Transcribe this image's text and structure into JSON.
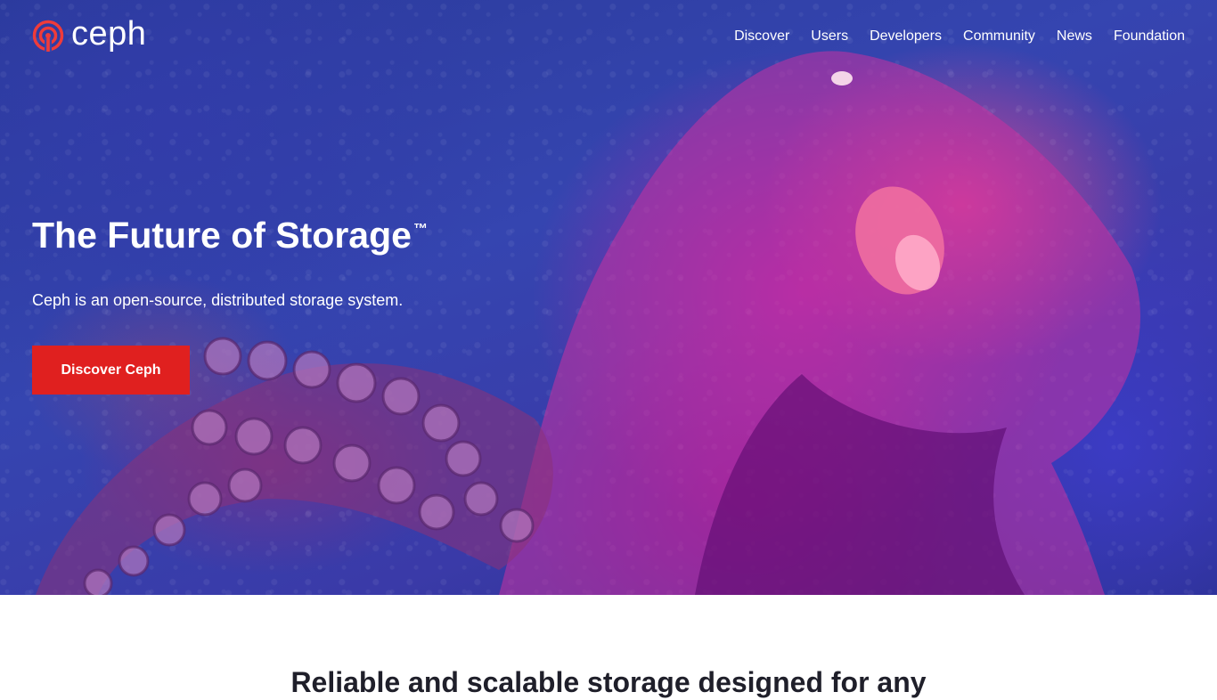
{
  "brand": {
    "name": "ceph",
    "logo_color": "#ef3b3a"
  },
  "nav": {
    "items": [
      {
        "label": "Discover"
      },
      {
        "label": "Users"
      },
      {
        "label": "Developers"
      },
      {
        "label": "Community"
      },
      {
        "label": "News"
      },
      {
        "label": "Foundation"
      }
    ]
  },
  "hero": {
    "title": "The Future of Storage",
    "trademark": "™",
    "subtitle": "Ceph is an open-source, distributed storage system.",
    "cta_label": "Discover Ceph",
    "cta_color": "#e0201f"
  },
  "section": {
    "heading": "Reliable and scalable storage designed for any"
  }
}
